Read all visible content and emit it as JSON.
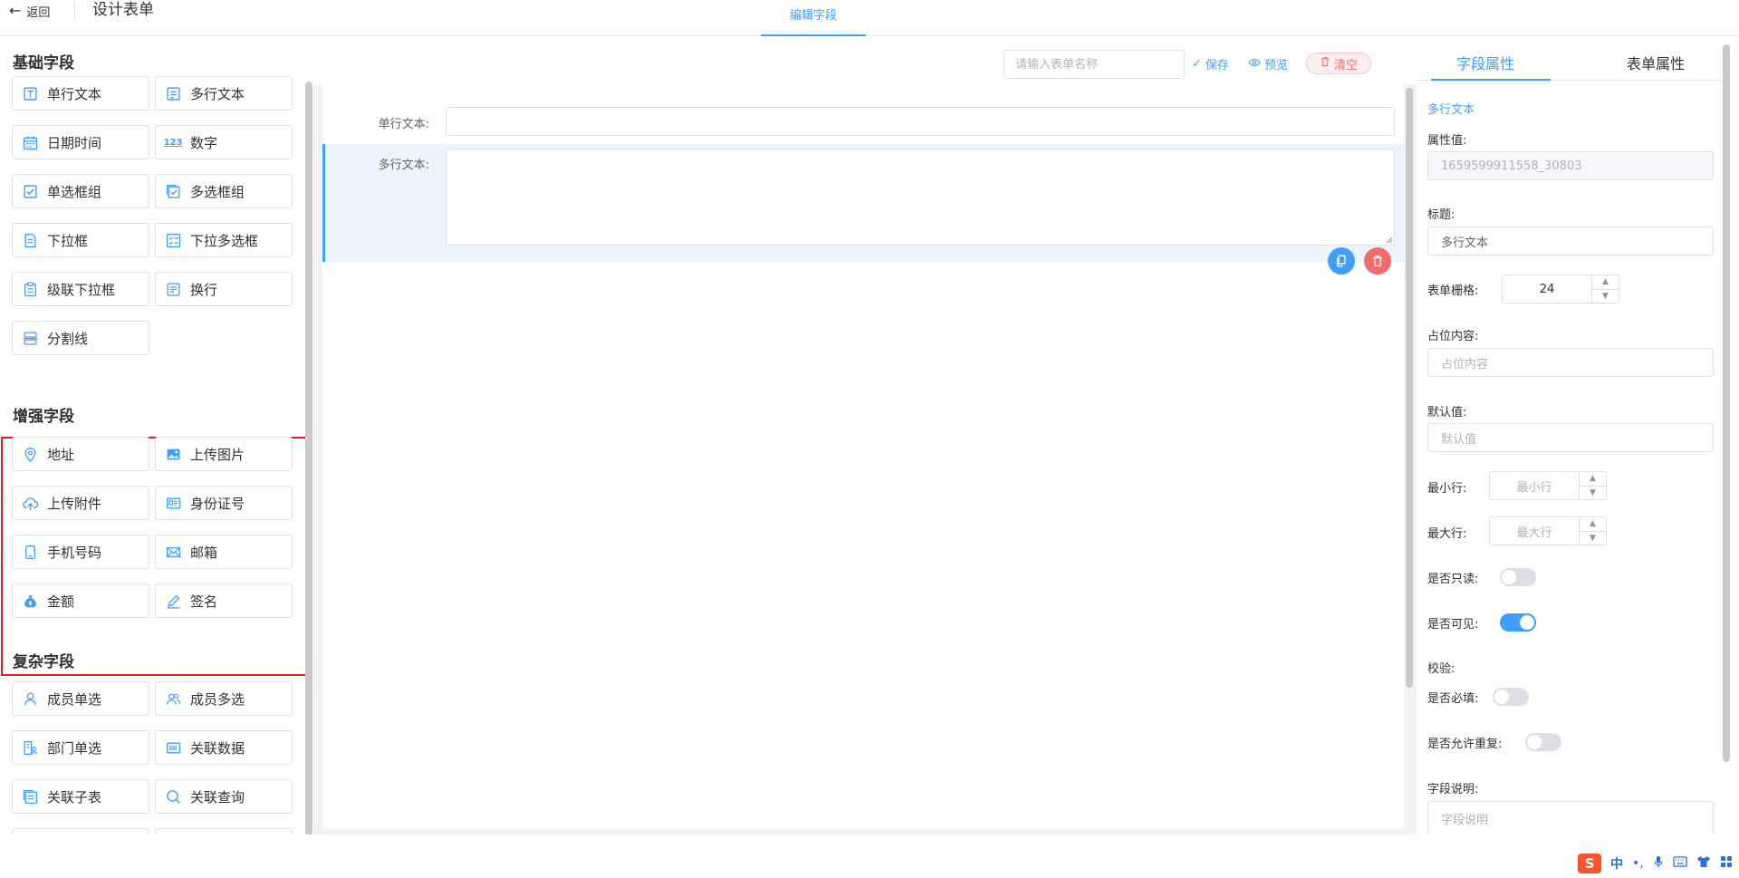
{
  "header": {
    "back_label": "返回",
    "page_title": "设计表单",
    "edit_tab": "编辑字段"
  },
  "left_panel": {
    "basic_title": "基础字段",
    "basic_fields": [
      "单行文本",
      "多行文本",
      "日期时间",
      "数字",
      "单选框组",
      "多选框组",
      "下拉框",
      "下拉多选框",
      "级联下拉框",
      "换行",
      "分割线"
    ],
    "enhanced_title": "增强字段",
    "enhanced_fields": [
      "地址",
      "上传图片",
      "上传附件",
      "身份证号",
      "手机号码",
      "邮箱",
      "金额",
      "签名"
    ],
    "complex_title": "复杂字段",
    "complex_fields": [
      "成员单选",
      "成员多选",
      "部门单选",
      "关联数据",
      "关联子表",
      "关联查询"
    ],
    "number_icon_text": "123"
  },
  "toolbar": {
    "form_name_placeholder": "请输入表单名称",
    "save_label": "保存",
    "preview_label": "预览",
    "clear_label": "清空"
  },
  "canvas": {
    "fields": [
      {
        "label": "单行文本:"
      },
      {
        "label": "多行文本:"
      }
    ]
  },
  "props": {
    "tab_field": "字段属性",
    "tab_form": "表单属性",
    "field_type": "多行文本",
    "attr_value_label": "属性值:",
    "attr_value": "1659599911558_30803",
    "title_label": "标题:",
    "title_value": "多行文本",
    "grid_label": "表单栅格:",
    "grid_value": "24",
    "placeholder_label": "占位内容:",
    "placeholder_ph": "占位内容",
    "default_label": "默认值:",
    "default_ph": "默认值",
    "min_rows_label": "最小行:",
    "min_rows_ph": "最小行",
    "max_rows_label": "最大行:",
    "max_rows_ph": "最大行",
    "readonly_label": "是否只读:",
    "readonly": false,
    "visible_label": "是否可见:",
    "visible": true,
    "validate_label": "校验:",
    "required_label": "是否必填:",
    "required": false,
    "repeat_label": "是否允许重复:",
    "repeat": false,
    "desc_label": "字段说明:",
    "desc_ph": "字段说明"
  },
  "tray": {
    "ime_logo": "S",
    "ime_lang": "中"
  },
  "colors": {
    "primary": "#409eff",
    "danger": "#f56c6c",
    "highlight_box": "#e02020"
  }
}
